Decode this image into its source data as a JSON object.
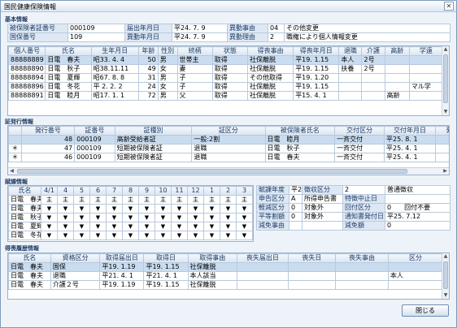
{
  "window": {
    "title": "国民健康保険情報",
    "close_glyph": "✕"
  },
  "sections": {
    "basic": "基本情報",
    "cert": "証発行情報",
    "tax": "賦課情報",
    "history": "得喪履歴情報"
  },
  "basic": {
    "rows": [
      [
        {
          "l": "被保険者証番号"
        },
        {
          "v": "000109"
        },
        {
          "l": "届出年月日"
        },
        {
          "v": "平24. 7. 9"
        },
        {
          "l": "異動事由"
        },
        {
          "v": "04"
        },
        {
          "v": "その他変更"
        }
      ],
      [
        {
          "l": "国保番号"
        },
        {
          "v": "109"
        },
        {
          "l": "異動年月日"
        },
        {
          "v": "平24. 7. 9"
        },
        {
          "l": "異動理由"
        },
        {
          "v": "2"
        },
        {
          "v": "職権により個人情報変更"
        }
      ]
    ]
  },
  "members": {
    "headers": [
      "個人番号",
      "氏名",
      "生年月日",
      "年齢",
      "性別",
      "続柄",
      "状態",
      "得喪事由",
      "得喪年月日",
      "退職",
      "介護",
      "高齢",
      "学遠"
    ],
    "rows": [
      [
        "88888889",
        "日電　春夫",
        "昭33. 4. 4",
        "50",
        "男",
        "世帯主",
        "取得",
        "社保離脱",
        "平19. 1.15",
        "本人",
        "2号",
        "",
        ""
      ],
      [
        "88888890",
        "日電　秋子",
        "昭38.11.11",
        "49",
        "女",
        "妻",
        "取得",
        "社保離脱",
        "平19. 1.15",
        "扶養",
        "2号",
        "",
        ""
      ],
      [
        "88888894",
        "日電　夏輝",
        "昭67. 8. 8",
        "31",
        "男",
        "子",
        "取得",
        "その他取得",
        "平19. 1.20",
        "",
        "",
        "",
        ""
      ],
      [
        "88888896",
        "日電　冬花",
        "平 2. 2. 2",
        "24",
        "女",
        "子",
        "取得",
        "社保離脱",
        "平19. 1.15",
        "",
        "",
        "",
        "マル学"
      ],
      [
        "88888891",
        "日電　睦月",
        "昭17. 1. 1",
        "72",
        "男",
        "父",
        "取得",
        "社保離脱",
        "平15. 4. 1",
        "",
        "",
        "高齢",
        ""
      ]
    ],
    "selected": 0
  },
  "cert": {
    "headers": [
      "",
      "発行番号",
      "証番号",
      "証種別",
      "証区分",
      "被保険者氏名",
      "交付区分",
      "交付年月日",
      "発"
    ],
    "rows": [
      [
        "",
        "48",
        "000109",
        "高齢受給者証",
        "一般:2割",
        "日電　睦月",
        "一斉交付",
        "平25. 8. 1",
        ""
      ],
      [
        "＊",
        "47",
        "000109",
        "短期被保険者証",
        "退職",
        "日電　秋子",
        "一斉交付",
        "平25. 4. 1",
        ""
      ],
      [
        "＊",
        "46",
        "000109",
        "短期被保険者証",
        "退職",
        "日電　春夫",
        "一斉交付",
        "平25. 4. 1",
        ""
      ]
    ],
    "selected": 0
  },
  "tax": {
    "headers": [
      "氏名",
      "4/1",
      "4",
      "5",
      "6",
      "7",
      "8",
      "9",
      "10",
      "11",
      "12",
      "1",
      "2",
      "3"
    ],
    "rows": [
      {
        "name": "日電　春夫",
        "cells": [
          "主",
          "主",
          "主",
          "主",
          "主",
          "主",
          "主",
          "主",
          "主",
          "主",
          "主",
          "主",
          "主"
        ]
      },
      {
        "name": "日電　春夫",
        "cells": [
          "▼",
          "▼",
          "▼",
          "▼",
          "▼",
          "▼",
          "▼",
          "▼",
          "▼",
          "▼",
          "▼",
          "▼",
          "▼"
        ]
      },
      {
        "name": "日電　秋子",
        "cells": [
          "▼",
          "▼",
          "▼",
          "▼",
          "▼",
          "▼",
          "▼",
          "▼",
          "▼",
          "▼",
          "▼",
          "▼",
          "▼"
        ]
      },
      {
        "name": "日電　夏輝",
        "cells": [
          "▼",
          "▼",
          "▼",
          "▼",
          "▼",
          "▼",
          "▼",
          "▼",
          "▼",
          "▼",
          "▼",
          "▼",
          "▼"
        ]
      },
      {
        "name": "日電　冬花",
        "cells": [
          "▼",
          "▼",
          "▼",
          "▼",
          "▼",
          "▼",
          "▼",
          "▼",
          "▼",
          "▼",
          "▼",
          "▼",
          "▼"
        ]
      }
    ],
    "info": [
      [
        {
          "l": "賦課年度"
        },
        {
          "v": "平25"
        },
        {
          "l": "徴収区分"
        },
        {
          "v": "2"
        },
        {
          "v": "普通徴収"
        }
      ],
      [
        {
          "l": "申告区分"
        },
        {
          "v": "A"
        },
        {
          "v": "所得申告書"
        },
        {
          "l": "特徴中止日"
        },
        {
          "v": ""
        }
      ],
      [
        {
          "l": "軽減区分"
        },
        {
          "v": "0"
        },
        {
          "v": "対象外"
        },
        {
          "l": "回付区分"
        },
        {
          "v": "0　　回付不要"
        }
      ],
      [
        {
          "l": "平等割額"
        },
        {
          "v": "0"
        },
        {
          "v": "対象外"
        },
        {
          "l": "通知書発付日"
        },
        {
          "v": "平25. 7.12"
        }
      ],
      [
        {
          "l": "減免事由"
        },
        {
          "v": ""
        },
        {
          "v": ""
        },
        {
          "l": "減免額"
        },
        {
          "v": "0"
        }
      ]
    ]
  },
  "history": {
    "headers": [
      "氏名",
      "資格区分",
      "取得届出日",
      "取得日",
      "取得事由",
      "喪失届出日",
      "喪失日",
      "喪失事由",
      "区分"
    ],
    "rows": [
      [
        "日電　春夫",
        "国保",
        "平19. 1.19",
        "平19. 1.15",
        "社保離脱",
        "",
        "",
        "",
        ""
      ],
      [
        "日電　春夫",
        "退職",
        "平21. 4. 1",
        "平21. 4. 1",
        "本人該当",
        "",
        "",
        "",
        "本人"
      ],
      [
        "日電　春夫",
        "介護２号",
        "平19. 1.19",
        "平19. 1.15",
        "社保離脱",
        "",
        "",
        "",
        ""
      ]
    ],
    "selected": 0
  },
  "buttons": {
    "close": "閉じる"
  }
}
